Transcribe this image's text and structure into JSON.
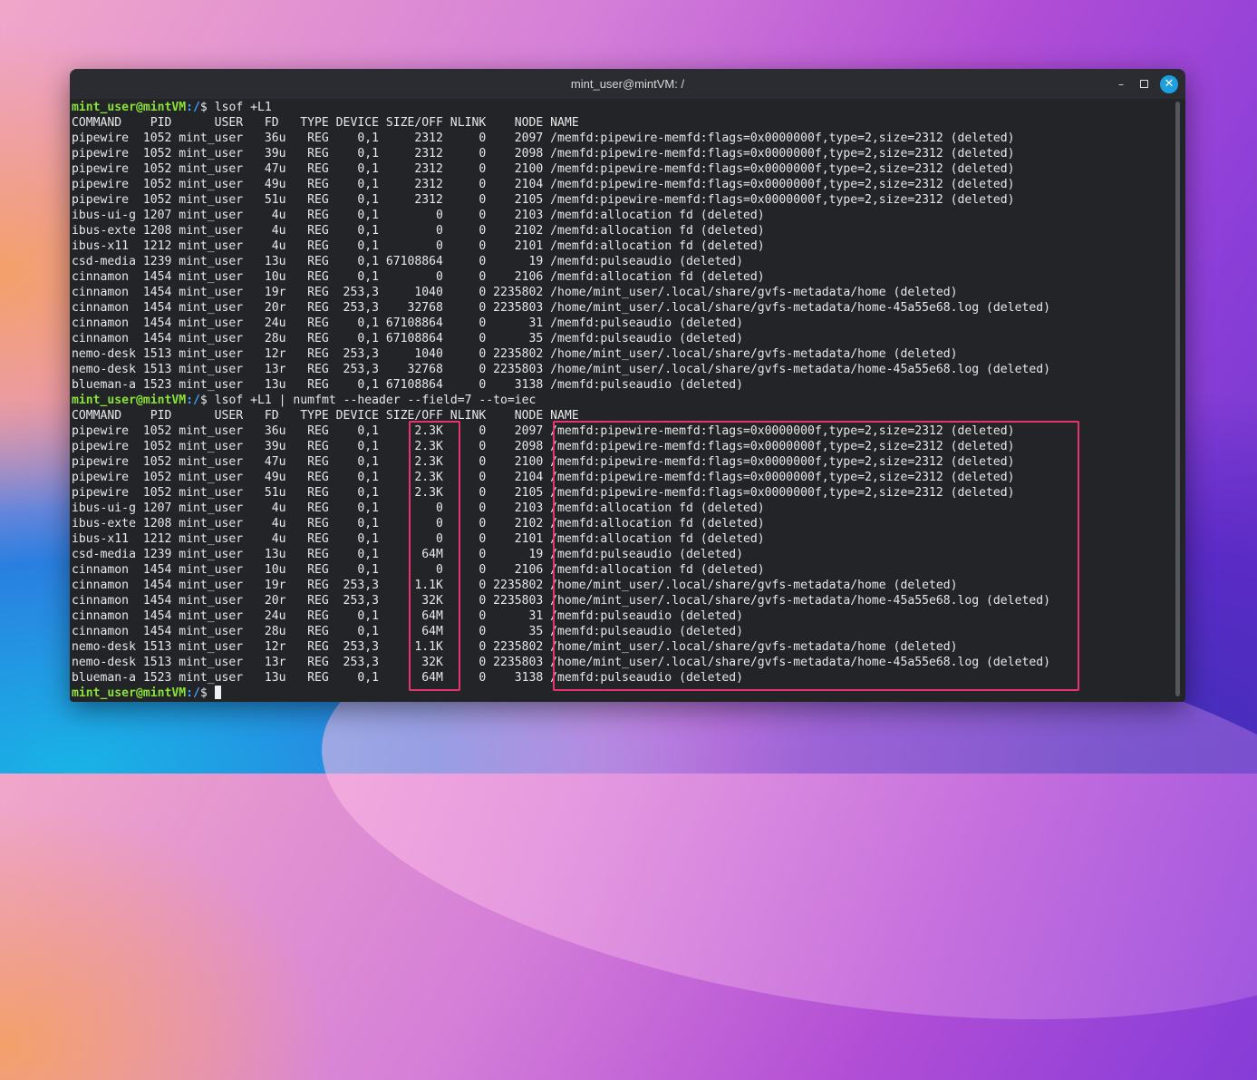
{
  "window": {
    "title": "mint_user@mintVM: /",
    "buttons": {
      "minimize": "–",
      "maximize": "",
      "close": "✕"
    }
  },
  "prompt": {
    "host": "mint_user@mintVM",
    "path": ":/",
    "symbol": "$"
  },
  "commands": [
    "lsof +L1",
    "lsof +L1 | numfmt --header --field=7 --to=iec"
  ],
  "output1": [
    "COMMAND    PID      USER   FD   TYPE DEVICE SIZE/OFF NLINK    NODE NAME",
    "pipewire  1052 mint_user   36u   REG    0,1     2312     0    2097 /memfd:pipewire-memfd:flags=0x0000000f,type=2,size=2312 (deleted)",
    "pipewire  1052 mint_user   39u   REG    0,1     2312     0    2098 /memfd:pipewire-memfd:flags=0x0000000f,type=2,size=2312 (deleted)",
    "pipewire  1052 mint_user   47u   REG    0,1     2312     0    2100 /memfd:pipewire-memfd:flags=0x0000000f,type=2,size=2312 (deleted)",
    "pipewire  1052 mint_user   49u   REG    0,1     2312     0    2104 /memfd:pipewire-memfd:flags=0x0000000f,type=2,size=2312 (deleted)",
    "pipewire  1052 mint_user   51u   REG    0,1     2312     0    2105 /memfd:pipewire-memfd:flags=0x0000000f,type=2,size=2312 (deleted)",
    "ibus-ui-g 1207 mint_user    4u   REG    0,1        0     0    2103 /memfd:allocation fd (deleted)",
    "ibus-exte 1208 mint_user    4u   REG    0,1        0     0    2102 /memfd:allocation fd (deleted)",
    "ibus-x11  1212 mint_user    4u   REG    0,1        0     0    2101 /memfd:allocation fd (deleted)",
    "csd-media 1239 mint_user   13u   REG    0,1 67108864     0      19 /memfd:pulseaudio (deleted)",
    "cinnamon  1454 mint_user   10u   REG    0,1        0     0    2106 /memfd:allocation fd (deleted)",
    "cinnamon  1454 mint_user   19r   REG  253,3     1040     0 2235802 /home/mint_user/.local/share/gvfs-metadata/home (deleted)",
    "cinnamon  1454 mint_user   20r   REG  253,3    32768     0 2235803 /home/mint_user/.local/share/gvfs-metadata/home-45a55e68.log (deleted)",
    "cinnamon  1454 mint_user   24u   REG    0,1 67108864     0      31 /memfd:pulseaudio (deleted)",
    "cinnamon  1454 mint_user   28u   REG    0,1 67108864     0      35 /memfd:pulseaudio (deleted)",
    "nemo-desk 1513 mint_user   12r   REG  253,3     1040     0 2235802 /home/mint_user/.local/share/gvfs-metadata/home (deleted)",
    "nemo-desk 1513 mint_user   13r   REG  253,3    32768     0 2235803 /home/mint_user/.local/share/gvfs-metadata/home-45a55e68.log (deleted)",
    "blueman-a 1523 mint_user   13u   REG    0,1 67108864     0    3138 /memfd:pulseaudio (deleted)"
  ],
  "output2": [
    "COMMAND    PID      USER   FD   TYPE DEVICE SIZE/OFF NLINK    NODE NAME",
    "pipewire  1052 mint_user   36u   REG    0,1     2.3K     0    2097 /memfd:pipewire-memfd:flags=0x0000000f,type=2,size=2312 (deleted)",
    "pipewire  1052 mint_user   39u   REG    0,1     2.3K     0    2098 /memfd:pipewire-memfd:flags=0x0000000f,type=2,size=2312 (deleted)",
    "pipewire  1052 mint_user   47u   REG    0,1     2.3K     0    2100 /memfd:pipewire-memfd:flags=0x0000000f,type=2,size=2312 (deleted)",
    "pipewire  1052 mint_user   49u   REG    0,1     2.3K     0    2104 /memfd:pipewire-memfd:flags=0x0000000f,type=2,size=2312 (deleted)",
    "pipewire  1052 mint_user   51u   REG    0,1     2.3K     0    2105 /memfd:pipewire-memfd:flags=0x0000000f,type=2,size=2312 (deleted)",
    "ibus-ui-g 1207 mint_user    4u   REG    0,1        0     0    2103 /memfd:allocation fd (deleted)",
    "ibus-exte 1208 mint_user    4u   REG    0,1        0     0    2102 /memfd:allocation fd (deleted)",
    "ibus-x11  1212 mint_user    4u   REG    0,1        0     0    2101 /memfd:allocation fd (deleted)",
    "csd-media 1239 mint_user   13u   REG    0,1      64M     0      19 /memfd:pulseaudio (deleted)",
    "cinnamon  1454 mint_user   10u   REG    0,1        0     0    2106 /memfd:allocation fd (deleted)",
    "cinnamon  1454 mint_user   19r   REG  253,3     1.1K     0 2235802 /home/mint_user/.local/share/gvfs-metadata/home (deleted)",
    "cinnamon  1454 mint_user   20r   REG  253,3      32K     0 2235803 /home/mint_user/.local/share/gvfs-metadata/home-45a55e68.log (deleted)",
    "cinnamon  1454 mint_user   24u   REG    0,1      64M     0      31 /memfd:pulseaudio (deleted)",
    "cinnamon  1454 mint_user   28u   REG    0,1      64M     0      35 /memfd:pulseaudio (deleted)",
    "nemo-desk 1513 mint_user   12r   REG  253,3     1.1K     0 2235802 /home/mint_user/.local/share/gvfs-metadata/home (deleted)",
    "nemo-desk 1513 mint_user   13r   REG  253,3      32K     0 2235803 /home/mint_user/.local/share/gvfs-metadata/home-45a55e68.log (deleted)",
    "blueman-a 1523 mint_user   13u   REG    0,1      64M     0    3138 /memfd:pulseaudio (deleted)"
  ],
  "colors": {
    "prompt_host": "#8ae234",
    "prompt_path": "#3da4ff",
    "highlight": "#e8336d",
    "close_button": "#1ea0e0"
  }
}
